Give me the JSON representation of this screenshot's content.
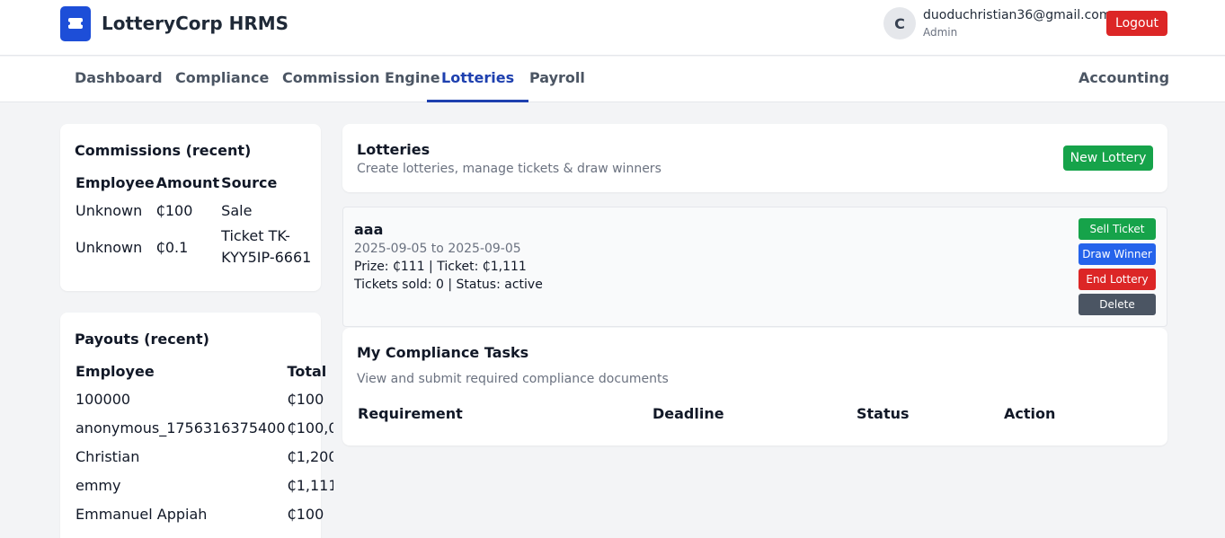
{
  "header": {
    "app_title": "LotteryCorp HRMS",
    "avatar_initial": "C",
    "user_email": "duoduchristian36@gmail.com",
    "user_role": "Admin",
    "logout_label": "Logout",
    "logo_icon": "ticket-icon"
  },
  "nav": {
    "tabs": [
      {
        "label": "Dashboard",
        "active": false
      },
      {
        "label": "Compliance",
        "active": false
      },
      {
        "label": "Commission Engine",
        "active": false
      },
      {
        "label": "Lotteries",
        "active": true
      },
      {
        "label": "Payroll",
        "active": false
      }
    ],
    "right_tab": "Accounting"
  },
  "commissions": {
    "title": "Commissions (recent)",
    "columns": [
      "Employee",
      "Amount",
      "Source"
    ],
    "rows": [
      {
        "employee": "Unknown",
        "amount": "₵100",
        "source": "Sale"
      },
      {
        "employee": "Unknown",
        "amount": "₵0.1",
        "source": "Ticket TK-KYY5IP-6661"
      }
    ]
  },
  "payouts": {
    "title": "Payouts (recent)",
    "columns": [
      "Employee",
      "Total"
    ],
    "rows": [
      {
        "employee": "100000",
        "total": "₵100"
      },
      {
        "employee": "anonymous_1756316375400",
        "total": "₵100,0"
      },
      {
        "employee": "Christian",
        "total": "₵1,200"
      },
      {
        "employee": "emmy",
        "total": "₵1,111"
      },
      {
        "employee": "Emmanuel Appiah",
        "total": "₵100"
      }
    ]
  },
  "lotteries": {
    "title": "Lotteries",
    "subtitle": "Create lotteries, manage tickets & draw winners",
    "new_button": "New Lottery",
    "items": [
      {
        "name": "aaa",
        "dates": "2025-09-05 to 2025-09-05",
        "prize_line": "Prize: ₵111 | Ticket: ₵1,111",
        "sold_line": "Tickets sold: 0 | Status: active",
        "actions": {
          "sell": "Sell Ticket",
          "draw": "Draw Winner",
          "end": "End Lottery",
          "delete": "Delete"
        }
      }
    ]
  },
  "compliance": {
    "title": "My Compliance Tasks",
    "subtitle": "View and submit required compliance documents",
    "columns": [
      "Requirement",
      "Deadline",
      "Status",
      "Action"
    ]
  },
  "colors": {
    "primary": "#1e40af",
    "logo": "#1d4ed8",
    "danger": "#dc2626",
    "success": "#16a34a",
    "info": "#2563eb",
    "neutral": "#4b5563"
  }
}
